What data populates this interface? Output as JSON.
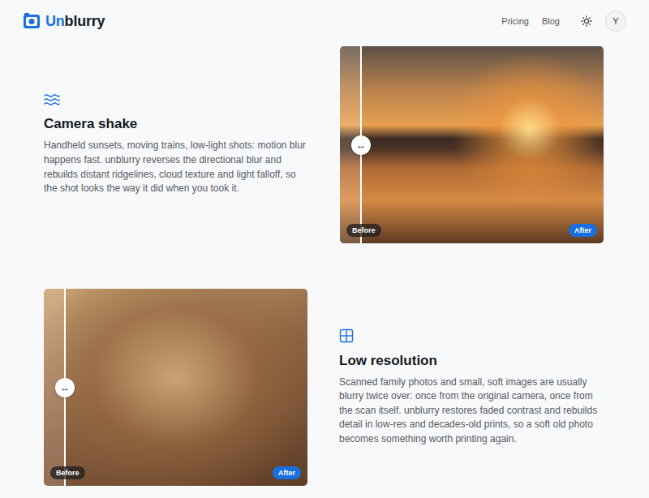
{
  "header": {
    "logo": [
      {
        "text": "Un",
        "color": "#1a6fe0"
      },
      {
        "text": "blurry",
        "color": "#15191f"
      }
    ],
    "nav": [
      "Pricing",
      "Blog"
    ],
    "avatar": "Y"
  },
  "features": [
    {
      "title": "Camera shake",
      "description": "Handheld sunsets, moving trains, low-light shots: motion blur happens fast. unblurry reverses the directional blur and rebuilds distant ridgelines, cloud texture and light falloff, so the shot looks the way it did when you took it.",
      "color": "#c97f3e",
      "slider": {
        "level": 0.08,
        "handle": "↔",
        "before": "Before",
        "after": "After"
      }
    },
    {
      "title": "Low resolution",
      "description": "Scanned family photos and small, soft images are usually blurry twice over: once from the original camera, once from the scan itself. unblurry restores faded contrast and rebuilds detail in low-res and decades-old prints, so a soft old photo becomes something worth printing again.",
      "color": "#9a7048",
      "slider": {
        "level": 0.08,
        "handle": "↔",
        "before": "Before",
        "after": "After"
      }
    }
  ]
}
